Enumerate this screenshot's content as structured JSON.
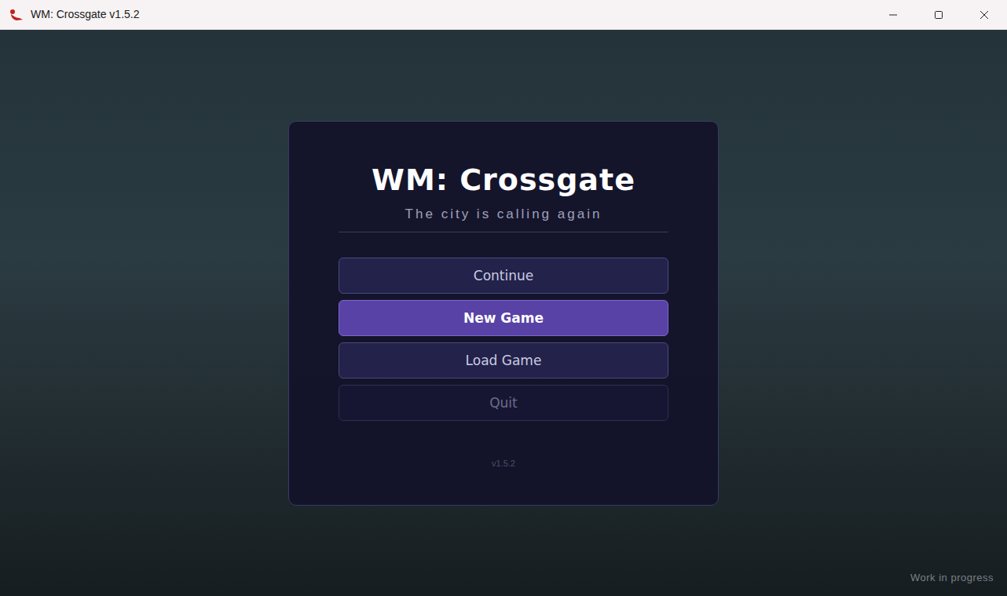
{
  "window": {
    "title": "WM: Crossgate v1.5.2"
  },
  "menu": {
    "title": "WM: Crossgate",
    "subtitle": "The city is calling again",
    "buttons": [
      {
        "label": "Continue",
        "kind": "secondary"
      },
      {
        "label": "New Game",
        "kind": "primary"
      },
      {
        "label": "Load Game",
        "kind": "secondary"
      },
      {
        "label": "Quit",
        "kind": "muted"
      }
    ],
    "version": "v1.5.2"
  },
  "footer": {
    "watermark": "Work in progress"
  }
}
